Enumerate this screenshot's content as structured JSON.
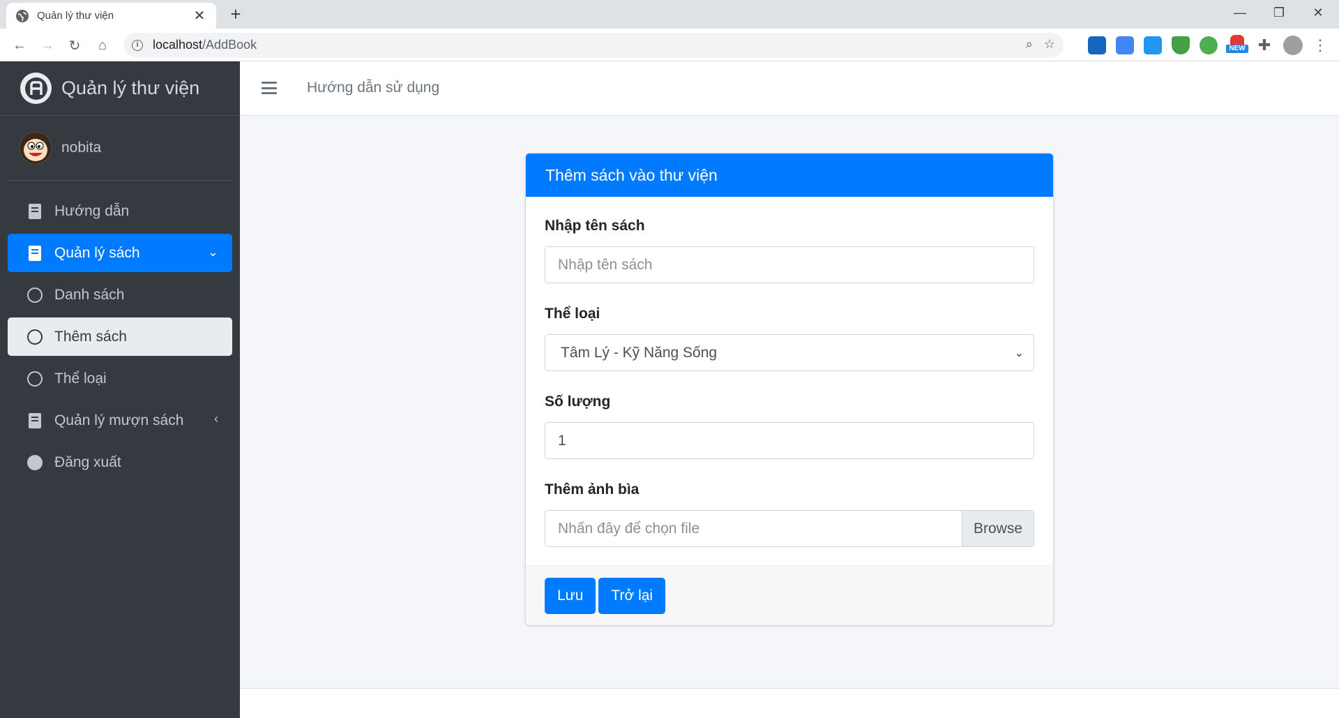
{
  "browser": {
    "tab_title": "Quản lý thư viện",
    "tab_close": "✕",
    "new_tab": "+",
    "url_host": "localhost",
    "url_path": "/AddBook",
    "ext_badge": "NEW"
  },
  "sidebar": {
    "brand": "Quản lý thư viện",
    "username": "nobita",
    "items": [
      {
        "label": "Hướng dẫn",
        "icon": "book-icon"
      },
      {
        "label": "Quản lý sách",
        "icon": "book-icon"
      },
      {
        "label": "Danh sách",
        "icon": "circle-icon"
      },
      {
        "label": "Thêm sách",
        "icon": "circle-icon"
      },
      {
        "label": "Thể loại",
        "icon": "circle-icon"
      },
      {
        "label": "Quản lý mượn sách",
        "icon": "book-icon"
      },
      {
        "label": "Đăng xuất",
        "icon": "dot-icon"
      }
    ]
  },
  "topnav": {
    "guide": "Hướng dẫn sử dụng"
  },
  "form": {
    "title": "Thêm sách vào thư viện",
    "name_label": "Nhập tên sách",
    "name_placeholder": "Nhập tên sách",
    "category_label": "Thể loại",
    "category_value": "Tâm Lý - Kỹ Năng Sống",
    "quantity_label": "Số lượng",
    "quantity_value": "1",
    "cover_label": "Thêm ảnh bìa",
    "cover_placeholder": "Nhấn đây để chọn file",
    "browse_label": "Browse",
    "save_label": "Lưu",
    "back_label": "Trở lại"
  },
  "colors": {
    "accent": "#007bff",
    "sidebar_bg": "#343a40",
    "page_bg": "#f4f6f9"
  }
}
